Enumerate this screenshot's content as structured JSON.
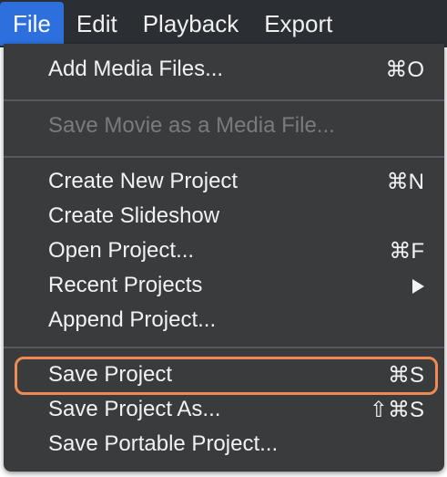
{
  "menubar": {
    "items": [
      "File",
      "Edit",
      "Playback",
      "Export"
    ]
  },
  "menu": {
    "add_media": {
      "label": "Add Media Files...",
      "shortcut": "⌘O"
    },
    "save_movie": {
      "label": "Save Movie as a Media File..."
    },
    "create_project": {
      "label": "Create New Project",
      "shortcut": "⌘N"
    },
    "create_slideshow": {
      "label": "Create Slideshow"
    },
    "open_project": {
      "label": "Open Project...",
      "shortcut": "⌘F"
    },
    "recent_projects": {
      "label": "Recent Projects"
    },
    "append_project": {
      "label": "Append Project..."
    },
    "save_project": {
      "label": "Save Project",
      "shortcut": "⌘S"
    },
    "save_project_as": {
      "label": "Save Project As...",
      "shortcut": "⇧⌘S"
    },
    "save_portable": {
      "label": "Save Portable Project..."
    }
  },
  "colors": {
    "menubar_bg": "#2b2f33",
    "active_tab": "#2d6fdc",
    "menu_bg": "#3a3b3d",
    "highlight": "#f08a55"
  }
}
